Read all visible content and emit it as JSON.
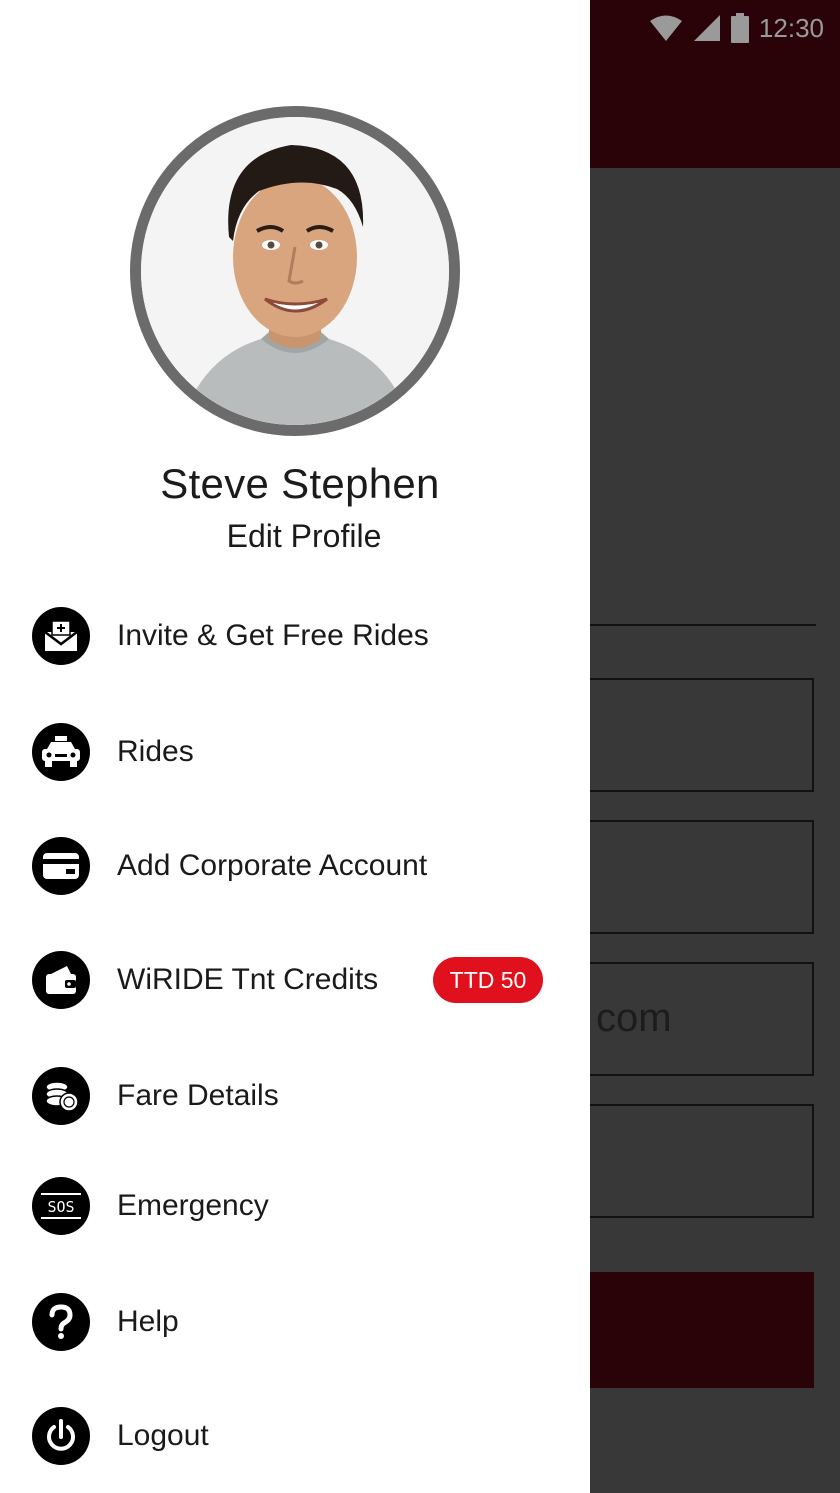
{
  "status_bar": {
    "time": "12:30"
  },
  "background": {
    "field_text": "com"
  },
  "profile": {
    "name": "Steve Stephen",
    "edit_label": "Edit Profile"
  },
  "menu": {
    "items": [
      {
        "label": "Invite & Get Free Rides",
        "icon": "invite-envelope-icon"
      },
      {
        "label": "Rides",
        "icon": "taxi-icon"
      },
      {
        "label": "Add Corporate Account",
        "icon": "card-icon"
      },
      {
        "label": "WiRIDE Tnt Credits",
        "icon": "wallet-icon",
        "badge": "TTD 50"
      },
      {
        "label": "Fare Details",
        "icon": "coins-icon"
      },
      {
        "label": "Emergency",
        "icon": "sos-icon"
      },
      {
        "label": "Help",
        "icon": "help-icon"
      },
      {
        "label": "Logout",
        "icon": "power-icon"
      }
    ]
  },
  "colors": {
    "accent": "#e0101c",
    "appbar": "#2a0308",
    "icon_bg": "#000000"
  }
}
